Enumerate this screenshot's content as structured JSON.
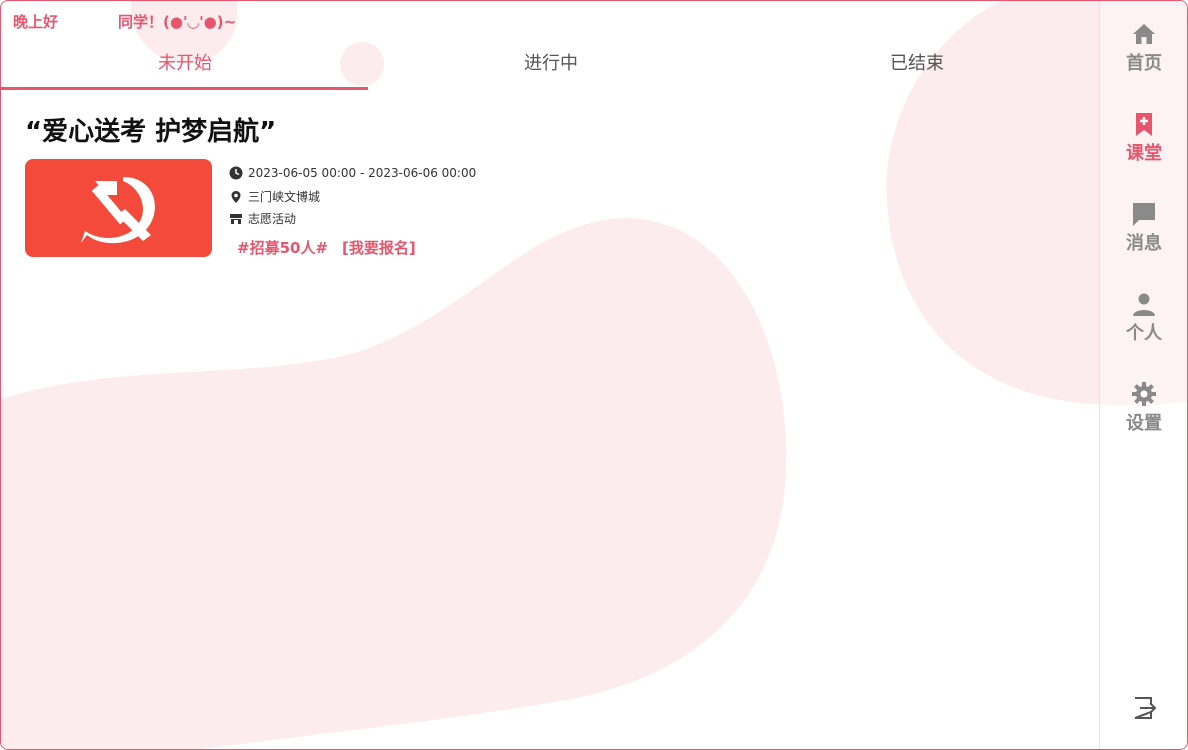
{
  "header": {
    "greeting_prefix": "晚上好",
    "greeting_suffix": "同学！(●'◡'●)~"
  },
  "tabs": [
    {
      "label": "未开始",
      "active": true
    },
    {
      "label": "进行中",
      "active": false
    },
    {
      "label": "已结束",
      "active": false
    }
  ],
  "activity": {
    "title": "“爱心送考 护梦启航”",
    "time": "2023-06-05 00:00 - 2023-06-06 00:00",
    "location": "三门峡文博城",
    "category": "志愿活动",
    "recruit_tag": "#招募50人#",
    "signup_label": "[我要报名]",
    "thumbnail_icon": "hammer-sickle-emblem",
    "thumbnail_color": "#f34a3b"
  },
  "sidebar": {
    "items": [
      {
        "label": "首页",
        "icon": "home-icon",
        "active": false
      },
      {
        "label": "课堂",
        "icon": "bookmark-plus-icon",
        "active": true
      },
      {
        "label": "消息",
        "icon": "message-icon",
        "active": false
      },
      {
        "label": "个人",
        "icon": "user-icon",
        "active": false
      },
      {
        "label": "设置",
        "icon": "gear-icon",
        "active": false
      }
    ],
    "logout_icon": "logout-icon"
  },
  "colors": {
    "accent": "#e8566e",
    "blob": "#fcecee",
    "muted": "#8a8a8a"
  }
}
